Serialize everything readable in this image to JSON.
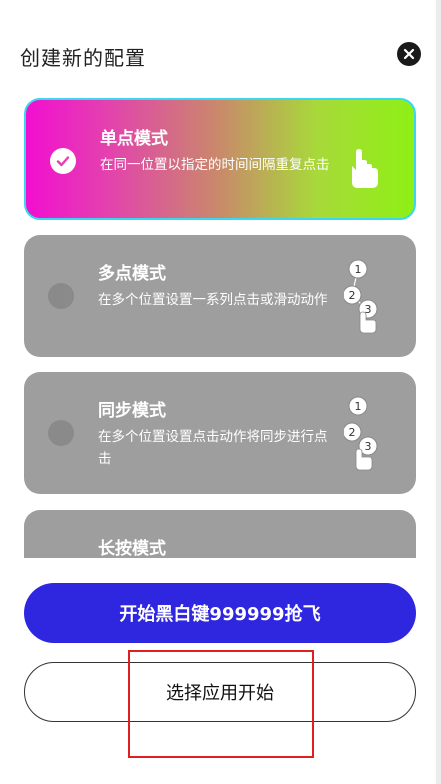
{
  "dialog": {
    "title": "创建新的配置",
    "close_icon": "close-icon"
  },
  "modes": [
    {
      "name": "单点模式",
      "description": "在同一位置以指定的时间间隔重复点击",
      "selected": true,
      "icon": "single-tap-hand-icon"
    },
    {
      "name": "多点模式",
      "description": "在多个位置设置一系列点击或滑动动作",
      "selected": false,
      "icon": "multi-tap-numbered-icon",
      "steps": [
        "1",
        "2",
        "3"
      ]
    },
    {
      "name": "同步模式",
      "description": "在多个位置设置点击动作将同步进行点击",
      "selected": false,
      "icon": "sync-tap-numbered-icon",
      "steps": [
        "1",
        "2",
        "3"
      ]
    },
    {
      "name": "长按模式",
      "description": "",
      "selected": false,
      "icon": "long-press-icon"
    }
  ],
  "actions": {
    "primary_label": "开始黑白键999999抢飞",
    "secondary_label": "选择应用开始"
  },
  "colors": {
    "primary_button": "#2f26e0",
    "card_inactive": "#9e9e9e",
    "selected_gradient_start": "#f20ed0",
    "selected_gradient_end": "#8ef015",
    "selected_border": "#3ad7f0",
    "highlight_box": "#e02020"
  }
}
